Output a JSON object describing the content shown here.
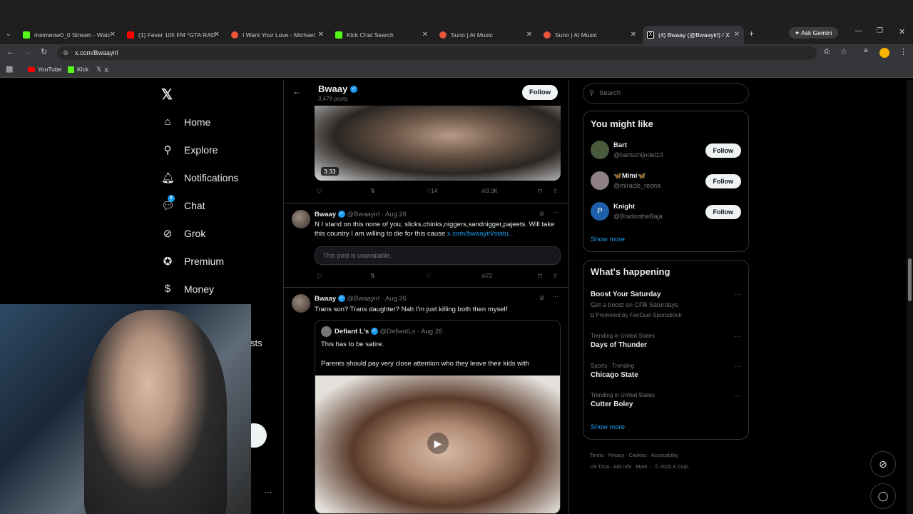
{
  "browser": {
    "tabs": [
      {
        "title": "meimeow0_0 Stream - Watc",
        "color": "#53fc18"
      },
      {
        "title": "(1) Fever 105 FM *GTA RAD",
        "color": "#ff0000"
      },
      {
        "title": "I Want Your Love - Michael",
        "color": "#e8553a"
      },
      {
        "title": "Kick Chat Search",
        "color": "#53fc18"
      },
      {
        "title": "Suno | AI Music",
        "color": "#e8553a"
      },
      {
        "title": "Suno | AI Music",
        "color": "#e8553a"
      },
      {
        "title": "(4) Bwaay (@Bwaayirl) / X",
        "color": "#ffffff"
      }
    ],
    "ask_gemini": "Ask Gemini",
    "url": "x.com/Bwaayirl",
    "bookmarks": [
      "YouTube",
      "Kick",
      "X"
    ]
  },
  "sidebar": {
    "logo": "X",
    "items": [
      {
        "label": "Home",
        "icon": "home-icon"
      },
      {
        "label": "Explore",
        "icon": "search-icon"
      },
      {
        "label": "Notifications",
        "icon": "bell-icon"
      },
      {
        "label": "Chat",
        "icon": "chat-icon"
      },
      {
        "label": "Grok",
        "icon": "grok-icon"
      },
      {
        "label": "Premium",
        "icon": "premium-icon"
      },
      {
        "label": "Money",
        "icon": "money-icon"
      }
    ],
    "partial_label": "sts",
    "chat_badge": "4"
  },
  "profile_header": {
    "name": "Bwaay",
    "posts": "3,478 posts",
    "follow": "Follow"
  },
  "posts": [
    {
      "video_duration": "3:33",
      "likes": "14",
      "views": "3.3K"
    },
    {
      "name": "Bwaay",
      "handle": "@Bwaayirl",
      "date": "· Aug 26",
      "text": "N I stand on this none of you, slicks,chinks,niggers,sandnigger,pajeets. Will take this country I am willing to die for this cause",
      "link": "x.com/bwaayirl/statu...",
      "unavailable": "This post is unavailable.",
      "views": "72"
    },
    {
      "name": "Bwaay",
      "handle": "@Bwaayirl",
      "date": "· Aug 26",
      "text": "Trans son? Trans daughter? Nah I'm just killing both then myself",
      "quote": {
        "name": "Defiant L's",
        "handle": "@DefiantLs",
        "date": "· Aug 26",
        "line1": "This has to be satire.",
        "line2": "Parents should pay very close attention who they leave their kids with"
      }
    }
  ],
  "right": {
    "search_placeholder": "Search",
    "you_might_like": "You might like",
    "suggestions": [
      {
        "name": "Bart",
        "handle": "@bartschijndel10"
      },
      {
        "name": "🦋Mimi🦋",
        "handle": "@miracle_reona"
      },
      {
        "name": "Knight",
        "handle": "@BradontheBaja"
      }
    ],
    "follow": "Follow",
    "show_more": "Show more",
    "whats_happening": "What's happening",
    "trends": [
      {
        "category": "Get a boost on CFB Saturdays",
        "name": "Boost Your Saturday",
        "promo": "Promoted by FanDuel Sportsbook"
      },
      {
        "category": "Trending in United States",
        "name": "Days of Thunder"
      },
      {
        "category": "Sports · Trending",
        "name": "Chicago State"
      },
      {
        "category": "Trending in United States",
        "name": "Cutter Boley"
      }
    ],
    "footer": [
      "Terms",
      "Privacy",
      "Cookies",
      "Accessibility",
      "US TIDA",
      "Ads info",
      "More ···",
      "© 2025 X Corp."
    ]
  }
}
